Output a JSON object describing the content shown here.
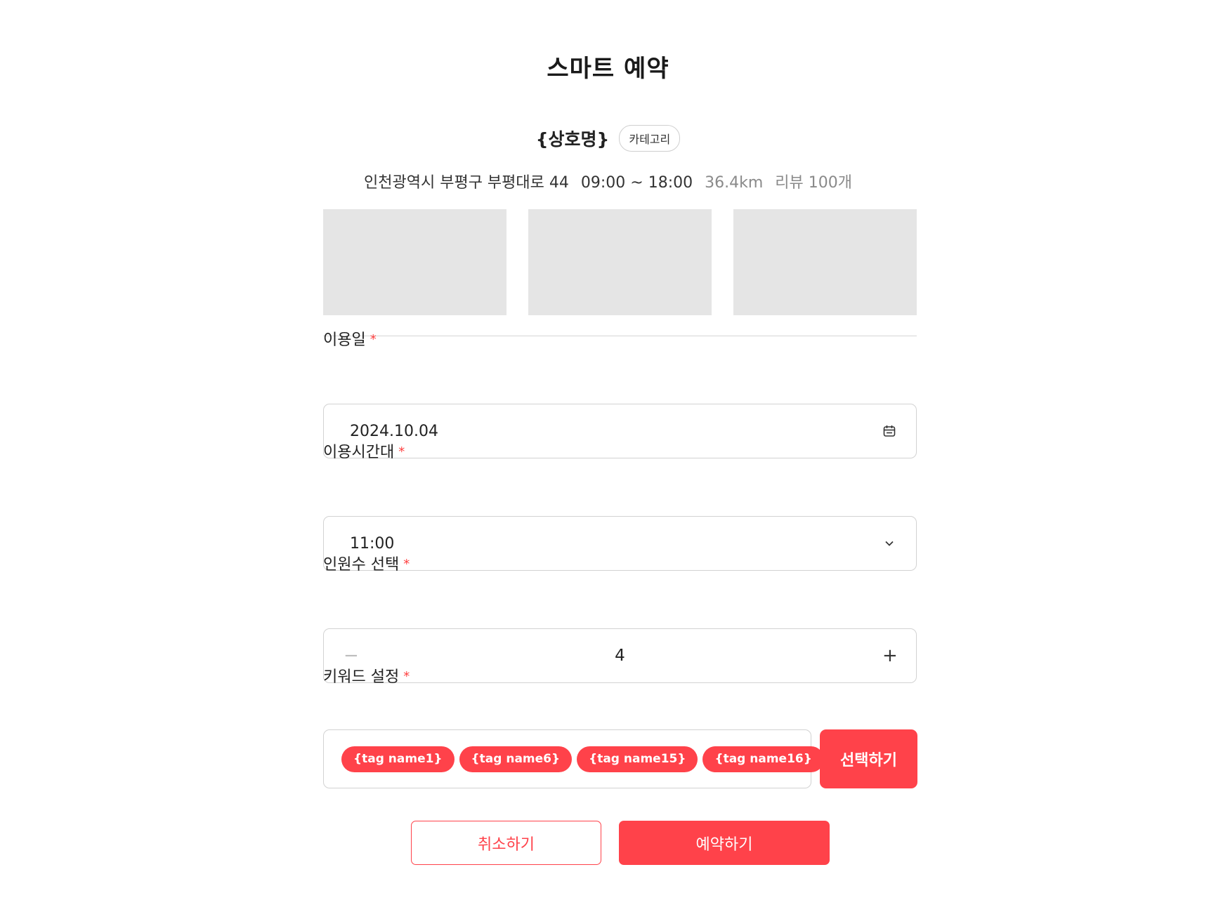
{
  "page": {
    "title": "스마트 예약"
  },
  "shop": {
    "name": "{상호명}",
    "category": "카테고리",
    "address": "인천광역시 부평구 부평대로 44",
    "hours": "09:00 ~ 18:00",
    "distance": "36.4km",
    "reviews": "리뷰 100개"
  },
  "form": {
    "date_label": "이용일",
    "date_value": "2024.10.04",
    "time_label": "이용시간대",
    "time_value": "11:00",
    "people_label": "인원수 선택",
    "people_minus": "−",
    "people_count": "4",
    "people_plus": "+",
    "keyword_label": "키워드 설정",
    "required_mark": "*",
    "tags": [
      "{tag name1}",
      "{tag name6}",
      "{tag name15}",
      "{tag name16}"
    ],
    "select_button": "선택하기"
  },
  "actions": {
    "cancel": "취소하기",
    "reserve": "예약하기"
  },
  "colors": {
    "accent": "#ff424a",
    "placeholder_image": "#e5e5e5",
    "border": "#d2d2d2"
  },
  "icons": {
    "date_field": "calendar-icon",
    "time_field": "chevron-down-icon"
  }
}
